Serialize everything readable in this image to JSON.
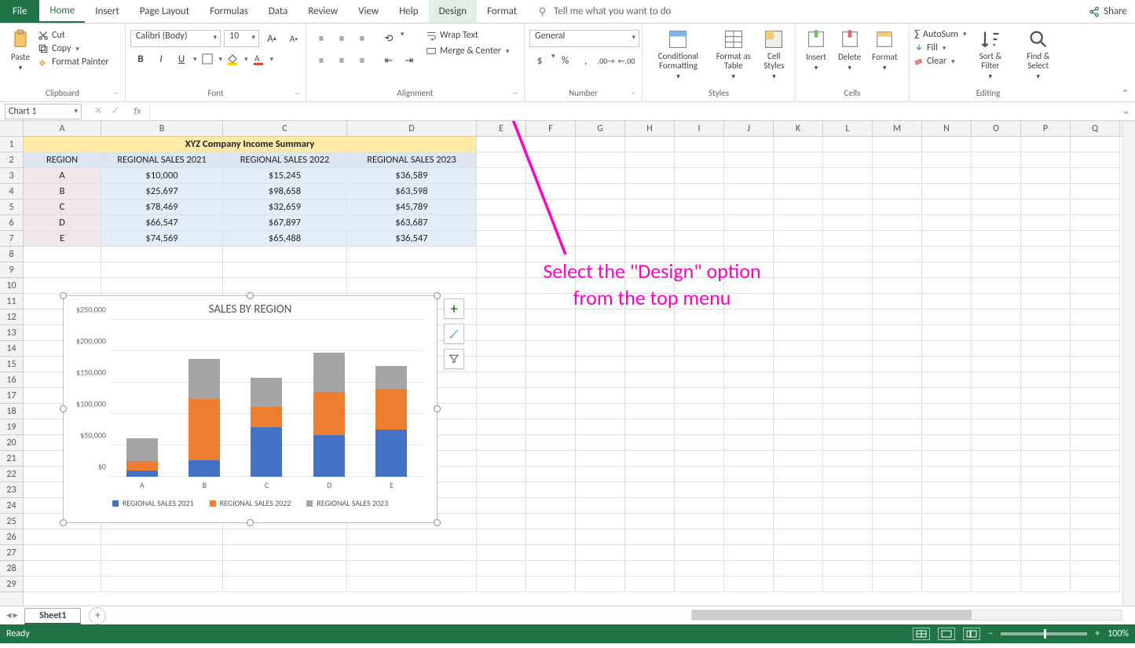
{
  "menubar": {
    "file": "File",
    "tabs": [
      "Home",
      "Insert",
      "Page Layout",
      "Formulas",
      "Data",
      "Review",
      "View",
      "Help",
      "Design",
      "Format"
    ],
    "active": "Home",
    "highlighted": "Design",
    "tell_me": "Tell me what you want to do",
    "share": "Share"
  },
  "ribbon": {
    "clipboard": {
      "label": "Clipboard",
      "paste": "Paste",
      "cut": "Cut",
      "copy": "Copy",
      "format_painter": "Format Painter"
    },
    "font": {
      "label": "Font",
      "name": "Calibri (Body)",
      "size": "10",
      "bold": "B",
      "italic": "I",
      "underline": "U"
    },
    "alignment": {
      "label": "Alignment",
      "wrap": "Wrap Text",
      "merge": "Merge & Center"
    },
    "number": {
      "label": "Number",
      "format": "General"
    },
    "styles": {
      "label": "Styles",
      "cond": "Conditional Formatting",
      "table": "Format as Table",
      "cell": "Cell Styles"
    },
    "cells": {
      "label": "Cells",
      "insert": "Insert",
      "delete": "Delete",
      "format": "Format"
    },
    "editing": {
      "label": "Editing",
      "autosum": "AutoSum",
      "fill": "Fill",
      "clear": "Clear",
      "sort": "Sort & Filter",
      "find": "Find & Select"
    }
  },
  "formula_bar": {
    "name_box": "Chart 1",
    "fx": "fx"
  },
  "col_widths": {
    "A": 99,
    "B": 155,
    "C": 158,
    "D": 165,
    "other": 63
  },
  "columns": [
    "A",
    "B",
    "C",
    "D",
    "E",
    "F",
    "G",
    "H",
    "I",
    "J",
    "K",
    "L",
    "M",
    "N",
    "O",
    "P",
    "Q"
  ],
  "table": {
    "title": "XYZ Company Income Summary",
    "headers": [
      "REGION",
      "REGIONAL SALES 2021",
      "REGIONAL SALES 2022",
      "REGIONAL SALES 2023"
    ],
    "rows": [
      [
        "A",
        "$10,000",
        "$15,245",
        "$36,589"
      ],
      [
        "B",
        "$25,697",
        "$98,658",
        "$63,598"
      ],
      [
        "C",
        "$78,469",
        "$32,659",
        "$45,789"
      ],
      [
        "D",
        "$66,547",
        "$67,897",
        "$63,687"
      ],
      [
        "E",
        "$74,569",
        "$65,488",
        "$36,547"
      ]
    ]
  },
  "chart_data": {
    "type": "bar",
    "stacked": true,
    "title": "SALES BY REGION",
    "categories": [
      "A",
      "B",
      "C",
      "D",
      "E"
    ],
    "series": [
      {
        "name": "REGIONAL SALES 2021",
        "color": "#4472c4",
        "values": [
          10000,
          25697,
          78469,
          66547,
          74569
        ]
      },
      {
        "name": "REGIONAL SALES 2022",
        "color": "#ed7d31",
        "values": [
          15245,
          98658,
          32659,
          67897,
          65488
        ]
      },
      {
        "name": "REGIONAL SALES 2023",
        "color": "#a5a5a5",
        "values": [
          36589,
          63598,
          45789,
          63687,
          36547
        ]
      }
    ],
    "ylim": [
      0,
      250000
    ],
    "yticks": [
      "$0",
      "$50,000",
      "$100,000",
      "$150,000",
      "$200,000",
      "$250,000"
    ]
  },
  "annotation": {
    "text_line1": "Select the \"Design\" option",
    "text_line2": "from the top menu"
  },
  "sheet": {
    "name": "Sheet1"
  },
  "status": {
    "ready": "Ready",
    "zoom": "100%"
  }
}
